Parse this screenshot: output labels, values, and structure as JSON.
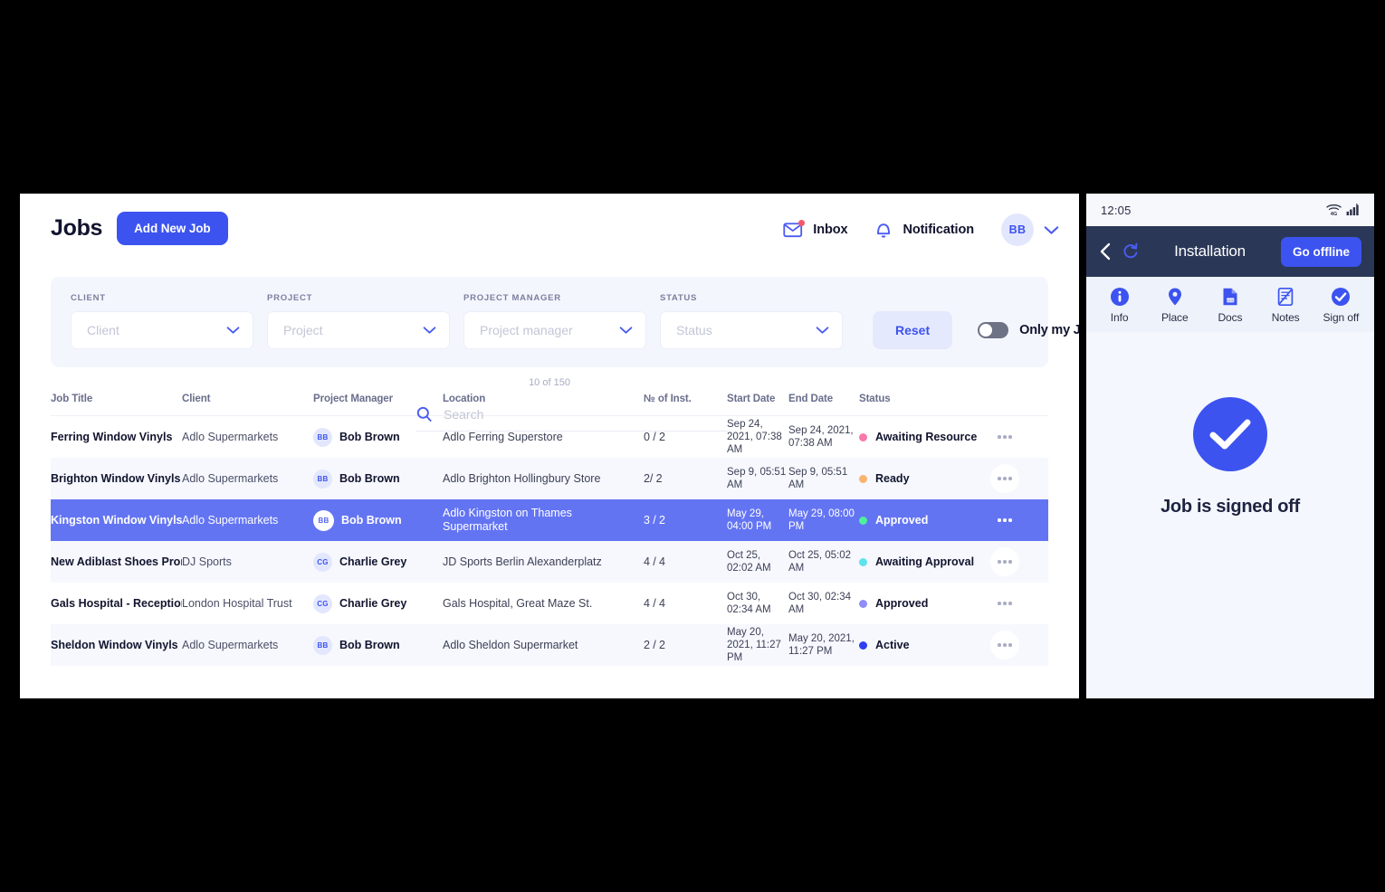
{
  "desktop": {
    "title": "Jobs",
    "add_job_label": "Add New Job",
    "search": {
      "placeholder": "Search",
      "value": ""
    },
    "header_actions": {
      "inbox_label": "Inbox",
      "notification_label": "Notification",
      "avatar_initials": "BB"
    },
    "filters": {
      "client": {
        "label": "CLIENT",
        "value": "Client"
      },
      "project": {
        "label": "PROJECT",
        "value": "Project"
      },
      "project_manager": {
        "label": "PROJECT MANAGER",
        "value": "Project manager"
      },
      "status": {
        "label": "STATUS",
        "value": "Status"
      },
      "reset_label": "Reset",
      "only_my_jobs_label": "Only my Jobs",
      "only_my_jobs_on": false
    },
    "result_count": "10 of 150",
    "table": {
      "columns": [
        "Job Title",
        "Client",
        "Project Manager",
        "Location",
        "№ of Inst.",
        "Start Date",
        "End Date",
        "Status",
        ""
      ],
      "rows": [
        {
          "job_title": "Ferring Window Vinyls",
          "client": "Adlo Supermarkets",
          "pm_initials": "BB",
          "pm_name": "Bob Brown",
          "location": "Adlo Ferring Superstore",
          "inst": "0 / 2",
          "start_date": "Sep 24, 2021, 07:38 AM",
          "end_date": "Sep 24, 2021, 07:38 AM",
          "status": "Awaiting Resource",
          "status_color": "#f878a9",
          "row_style": "plain"
        },
        {
          "job_title": "Brighton Window Vinyls",
          "client": "Adlo Supermarkets",
          "pm_initials": "BB",
          "pm_name": "Bob Brown",
          "location": "Adlo Brighton Hollingbury Store",
          "inst": "2/ 2",
          "start_date": "Sep 9, 05:51 AM",
          "end_date": "Sep 9, 05:51 AM",
          "status": "Ready",
          "status_color": "#fbb36d",
          "row_style": "alt"
        },
        {
          "job_title": "Kingston Window Vinyls",
          "client": "Adlo Supermarkets",
          "pm_initials": "BB",
          "pm_name": "Bob Brown",
          "location": "Adlo Kingston on Thames Supermarket",
          "inst": "3 / 2",
          "start_date": "May 29, 04:00 PM",
          "end_date": "May 29, 08:00 PM",
          "status": "Approved",
          "status_color": "#4ef09a",
          "row_style": "sel"
        },
        {
          "job_title": "New Adiblast Shoes Prom",
          "client": "DJ Sports",
          "pm_initials": "CG",
          "pm_name": "Charlie Grey",
          "location": "JD Sports Berlin Alexanderplatz",
          "inst": "4 / 4",
          "start_date": "Oct 25, 02:02 AM",
          "end_date": "Oct 25, 05:02 AM",
          "status": "Awaiting Approval",
          "status_color": "#5de3ec",
          "row_style": "alt"
        },
        {
          "job_title": "Gals Hospital - Reception",
          "client": "London Hospital Trust",
          "pm_initials": "CG",
          "pm_name": "Charlie Grey",
          "location": "Gals Hospital, Great Maze St.",
          "inst": "4 / 4",
          "start_date": "Oct 30, 02:34 AM",
          "end_date": "Oct 30, 02:34 AM",
          "status": "Approved",
          "status_color": "#8f8ef5",
          "row_style": "plain"
        },
        {
          "job_title": "Sheldon Window Vinyls",
          "client": "Adlo Supermarkets",
          "pm_initials": "BB",
          "pm_name": "Bob Brown",
          "location": "Adlo Sheldon Supermarket",
          "inst": "2 / 2",
          "start_date": "May 20, 2021, 11:27 PM",
          "end_date": "May 20, 2021, 11:27 PM",
          "status": "Active",
          "status_color": "#2f3ef0",
          "row_style": "alt"
        }
      ]
    }
  },
  "mobile": {
    "statusbar": {
      "time": "12:05",
      "network": "4G"
    },
    "header": {
      "title": "Installation",
      "offline_button": "Go offline"
    },
    "tabs": [
      {
        "label": "Info",
        "icon": "info-circle-icon"
      },
      {
        "label": "Place",
        "icon": "map-pin-icon"
      },
      {
        "label": "Docs",
        "icon": "document-icon"
      },
      {
        "label": "Notes",
        "icon": "note-pen-icon"
      },
      {
        "label": "Sign off",
        "icon": "check-circle-icon"
      }
    ],
    "body": {
      "message": "Job is signed off"
    }
  },
  "colors": {
    "accent": "#3c53f0",
    "selected_row": "#6374f3",
    "mobile_header": "#2a3757",
    "alt_row": "#f6f8fe"
  }
}
